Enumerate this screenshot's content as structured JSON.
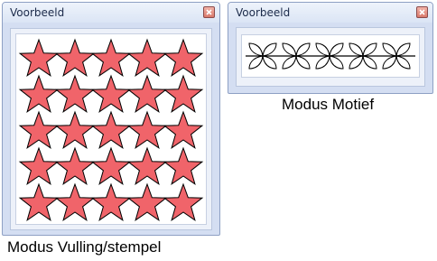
{
  "windows": {
    "fill": {
      "title": "Voorbeeld",
      "caption": "Modus Vulling/stempel",
      "pattern": "star-grid",
      "rows": 5,
      "columns": 5
    },
    "motif": {
      "title": "Voorbeeld",
      "caption": "Modus Motief",
      "pattern": "flower-motif-line",
      "motif_count": 5
    }
  },
  "colors": {
    "star_fill": "#f0646a",
    "outline": "#000000",
    "window_frame": "#d4def2",
    "canvas": "#ffffff"
  },
  "icons": {
    "close": "close-icon",
    "star": "star-icon",
    "motif": "flower-motif-icon"
  }
}
